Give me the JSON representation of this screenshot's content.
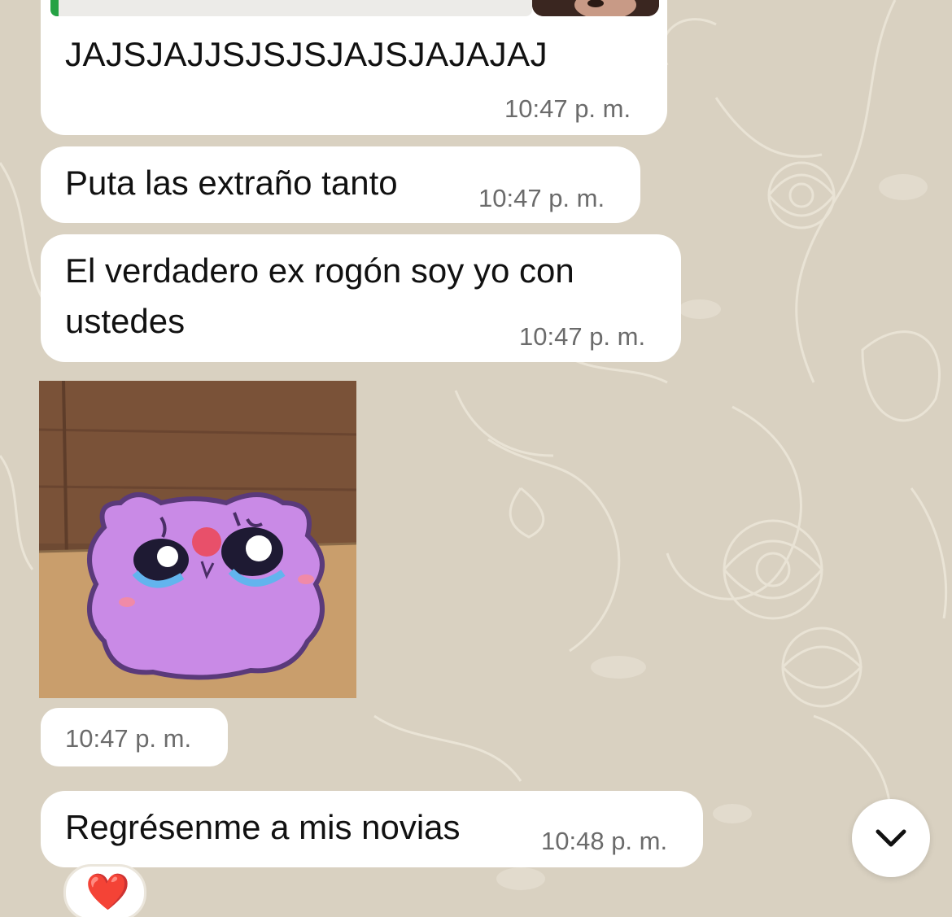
{
  "messages": [
    {
      "text": "JAJSJAJJSJSJSJAJSJAJAJAJ",
      "time": "10:47 p. m."
    },
    {
      "text": "Puta las extraño tanto",
      "time": "10:47 p. m."
    },
    {
      "text_line1": "El verdadero ex rogón soy yo con",
      "text_line2": "ustedes",
      "time": "10:47 p. m."
    },
    {
      "type": "sticker",
      "description_icon": "crying-purple-creature-sticker",
      "time": "10:47 p. m."
    },
    {
      "text": "Regrésenme a mis novias",
      "time": "10:48 p. m."
    }
  ],
  "reaction": {
    "emoji": "❤️"
  },
  "scroll_button": {
    "icon": "chevron-down-icon"
  },
  "colors": {
    "bubble": "#ffffff",
    "wallpaper": "#d8d0c0",
    "time_text": "#6b6b6b",
    "quote_accent": "#25a244"
  }
}
